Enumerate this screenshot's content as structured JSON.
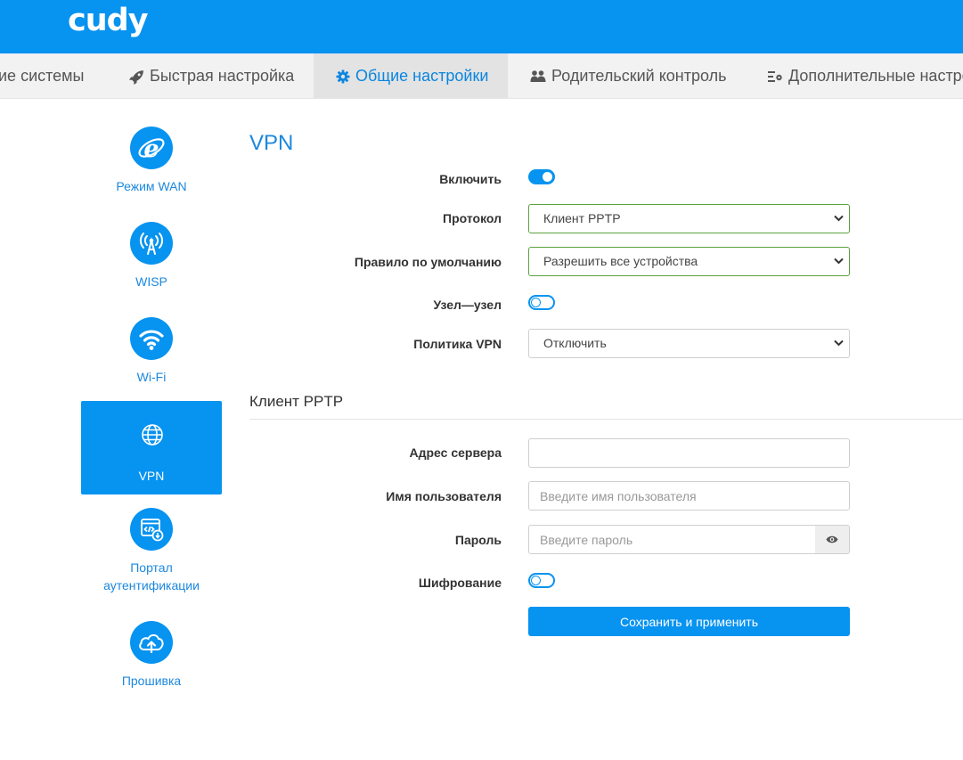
{
  "brand": {
    "logo_text": "cudy",
    "header_color": "#0793f0"
  },
  "nav": {
    "tabs": [
      {
        "label": "ие системы",
        "icon": ""
      },
      {
        "label": "Быстрая настройка",
        "icon": "rocket-icon"
      },
      {
        "label": "Общие настройки",
        "icon": "gear-icon",
        "active": true
      },
      {
        "label": "Родительский контроль",
        "icon": "users-icon"
      },
      {
        "label": "Дополнительные настро",
        "icon": "advanced-settings-icon"
      }
    ]
  },
  "sidebar": {
    "items": [
      {
        "label": "Режим WAN",
        "icon": "internet-explorer-icon"
      },
      {
        "label": "WISP",
        "icon": "wireless-antenna-icon"
      },
      {
        "label": "Wi-Fi",
        "icon": "wifi-icon"
      },
      {
        "label": "VPN",
        "icon": "globe-icon",
        "active": true
      },
      {
        "label": "Портал аутентификации",
        "icon": "auth-portal-icon"
      },
      {
        "label": "Прошивка",
        "icon": "cloud-upload-icon"
      }
    ]
  },
  "main": {
    "title": "VPN",
    "vpn": {
      "enable_label": "Включить",
      "enable": true,
      "protocol_label": "Протокол",
      "protocol_value": "Клиент PPTP",
      "default_rule_label": "Правило по умолчанию",
      "default_rule_value": "Разрешить все устройства",
      "site_to_site_label": "Узел—узел",
      "site_to_site": false,
      "vpn_policy_label": "Политика VPN",
      "vpn_policy_value": "Отключить"
    },
    "pptp": {
      "section_title": "Клиент PPTP",
      "server_label": "Адрес сервера",
      "server_value": "",
      "username_label": "Имя пользователя",
      "username_placeholder": "Введите имя пользователя",
      "password_label": "Пароль",
      "password_placeholder": "Введите пароль",
      "encryption_label": "Шифрование",
      "encryption": false,
      "save_label": "Сохранить и применить"
    }
  }
}
